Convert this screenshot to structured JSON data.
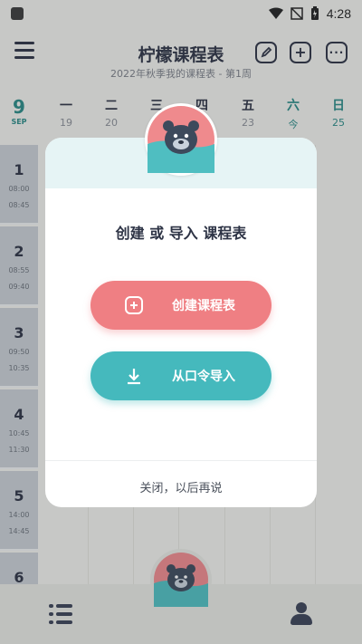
{
  "status_bar": {
    "time": "4:28"
  },
  "header": {
    "title": "柠檬课程表",
    "subtitle": "2022年秋季我的课程表 - 第1周"
  },
  "week": {
    "month_number": "9",
    "month_label": "SEP",
    "days": [
      {
        "name": "一",
        "date": "19"
      },
      {
        "name": "二",
        "date": "20"
      },
      {
        "name": "三",
        "date": "21"
      },
      {
        "name": "四",
        "date": "22"
      },
      {
        "name": "五",
        "date": "23"
      },
      {
        "name": "六",
        "date": "今"
      },
      {
        "name": "日",
        "date": "25"
      }
    ]
  },
  "periods": [
    {
      "number": "1",
      "start": "08:00",
      "end": "08:45"
    },
    {
      "number": "2",
      "start": "08:55",
      "end": "09:40"
    },
    {
      "number": "3",
      "start": "09:50",
      "end": "10:35"
    },
    {
      "number": "4",
      "start": "10:45",
      "end": "11:30"
    },
    {
      "number": "5",
      "start": "14:00",
      "end": "14:45"
    },
    {
      "number": "6",
      "start": "",
      "end": ""
    }
  ],
  "dialog": {
    "heading": "创建 或 导入 课程表",
    "create_label": "创建课程表",
    "import_label": "从口令导入",
    "close_label": "关闭，以后再说"
  },
  "colors": {
    "accent_teal": "#45b9bd",
    "accent_pink": "#ef7f83",
    "weekend_text": "#2a8a86"
  },
  "icons": {
    "menu": "menu-icon",
    "edit": "edit-icon",
    "add": "add-icon",
    "more": "more-icon",
    "list": "list-icon",
    "profile": "profile-icon",
    "create": "add-square-icon",
    "import": "download-icon"
  }
}
